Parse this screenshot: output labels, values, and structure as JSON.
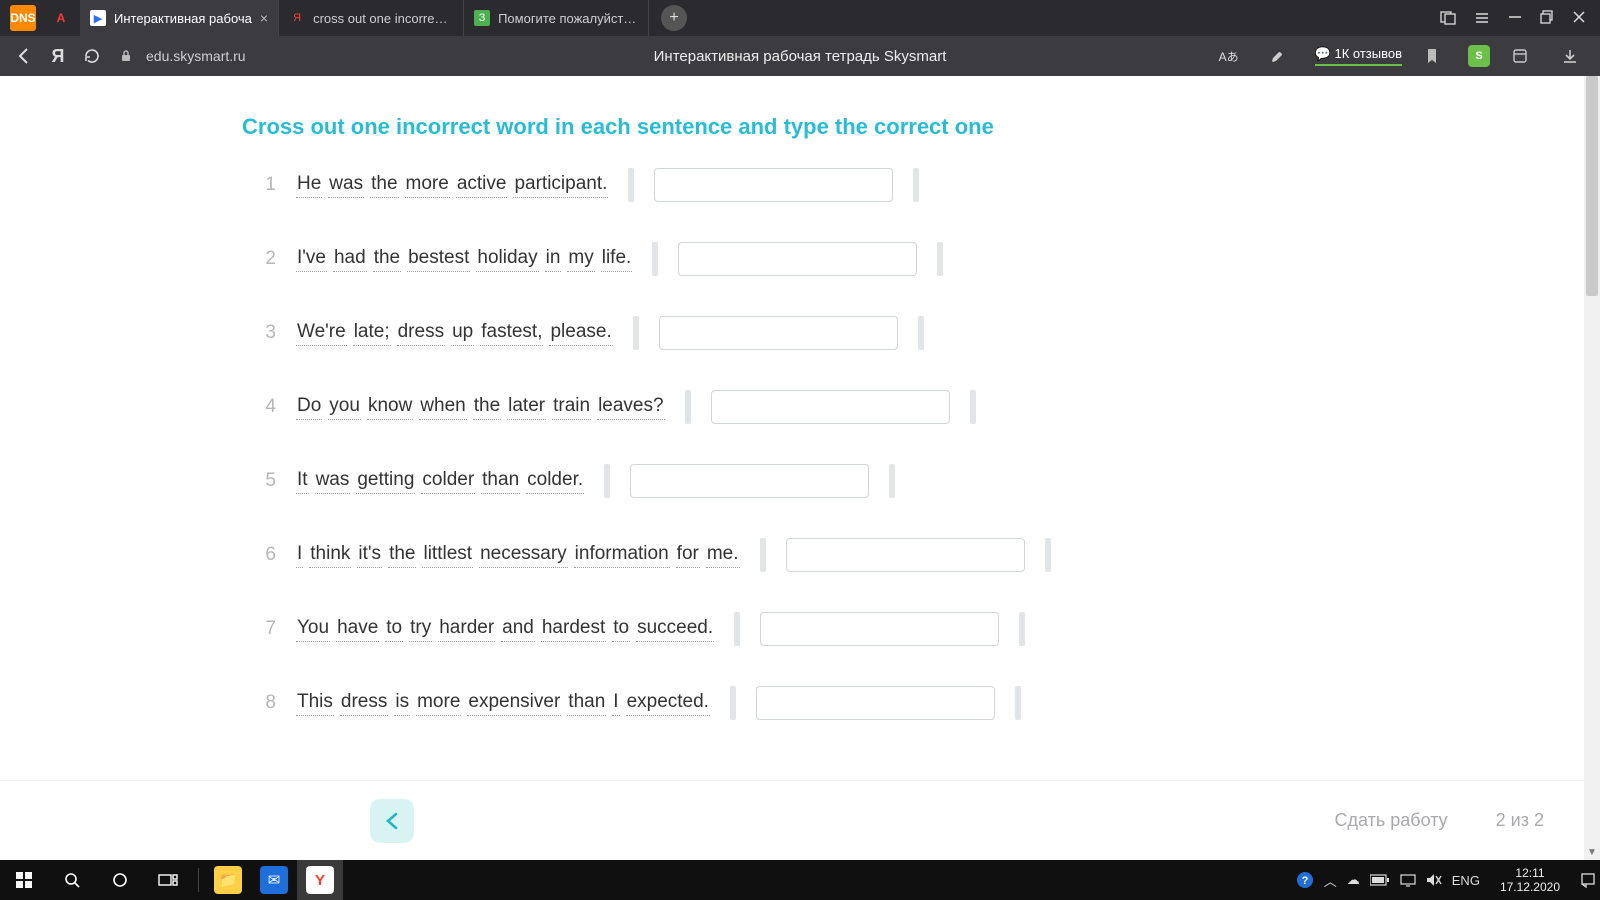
{
  "browser": {
    "tabs": [
      {
        "title": "Интерактивная рабоча",
        "favicon_bg": "#ffffff",
        "favicon_text": "▶",
        "favicon_color": "#2b6cff",
        "active": true,
        "closable": true
      },
      {
        "title": "cross out one incorrect wo",
        "favicon_bg": "transparent",
        "favicon_text": "Я",
        "favicon_color": "#ff3b30",
        "active": false,
        "closable": false
      },
      {
        "title": "Помогите пожалуйста ре",
        "favicon_bg": "#4caf50",
        "favicon_text": "З",
        "favicon_color": "#ffffff",
        "active": false,
        "closable": false
      }
    ],
    "pinned_left": [
      {
        "bg": "#ff8a00",
        "text": "DNS",
        "color": "#ffffff"
      },
      {
        "bg": "transparent",
        "text": "А",
        "color": "#ff3b30"
      }
    ],
    "address": "edu.skysmart.ru",
    "page_title": "Интерактивная рабочая тетрадь Skysmart",
    "reviews_label": "1К отзывов",
    "shield_label": "S"
  },
  "exercise": {
    "title": "Cross out one incorrect word in each sentence and type the correct one",
    "items": [
      {
        "n": "1",
        "words": [
          "He",
          "was",
          "the",
          "more",
          "active",
          "participant."
        ]
      },
      {
        "n": "2",
        "words": [
          "I've",
          "had",
          "the",
          "bestest",
          "holiday",
          "in",
          "my",
          "life."
        ]
      },
      {
        "n": "3",
        "words": [
          "We're",
          "late;",
          "dress",
          "up",
          "fastest,",
          "please."
        ]
      },
      {
        "n": "4",
        "words": [
          "Do",
          "you",
          "know",
          "when",
          "the",
          "later",
          "train",
          "leaves?"
        ]
      },
      {
        "n": "5",
        "words": [
          "It",
          "was",
          "getting",
          "colder",
          "than",
          "colder."
        ]
      },
      {
        "n": "6",
        "words": [
          "I",
          "think",
          "it's",
          "the",
          "littlest",
          "necessary",
          "information",
          "for",
          "me."
        ]
      },
      {
        "n": "7",
        "words": [
          "You",
          "have",
          "to",
          "try",
          "harder",
          "and",
          "hardest",
          "to",
          "succeed."
        ]
      },
      {
        "n": "8",
        "words": [
          "This",
          "dress",
          "is",
          "more",
          "expensiver",
          "than",
          "I",
          "expected."
        ]
      }
    ]
  },
  "footer": {
    "submit": "Сдать работу",
    "progress": "2 из 2"
  },
  "taskbar": {
    "lang": "ENG",
    "time": "12:11",
    "date": "17.12.2020"
  }
}
